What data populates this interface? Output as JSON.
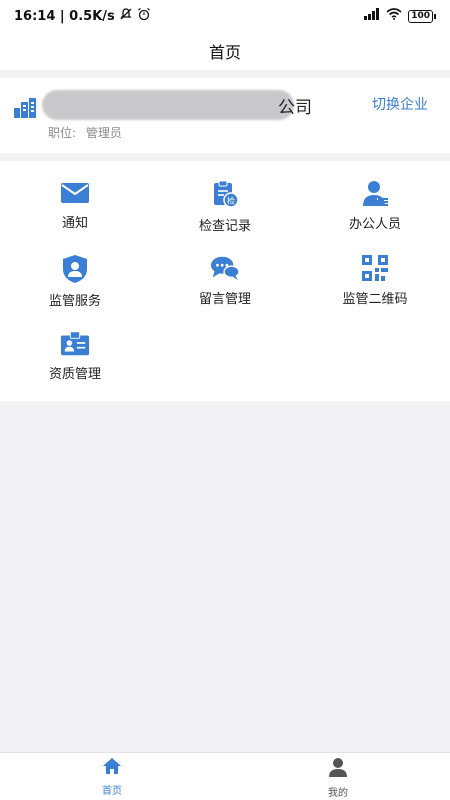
{
  "status_bar": {
    "time_speed": "16:14 | 0.5K/s",
    "battery": "100"
  },
  "nav": {
    "title": "首页"
  },
  "company": {
    "name_visible_suffix": "公司",
    "switch_label": "切换企业",
    "role_label": "职位:",
    "role_value": "管理员"
  },
  "menu": {
    "items": [
      {
        "label": "通知",
        "icon": "mail-icon"
      },
      {
        "label": "检查记录",
        "icon": "inspection-record-icon"
      },
      {
        "label": "办公人员",
        "icon": "staff-icon"
      },
      {
        "label": "监管服务",
        "icon": "shield-user-icon"
      },
      {
        "label": "留言管理",
        "icon": "chat-bubbles-icon"
      },
      {
        "label": "监管二维码",
        "icon": "qr-code-icon"
      },
      {
        "label": "资质管理",
        "icon": "id-card-icon"
      }
    ]
  },
  "tabs": [
    {
      "label": "首页",
      "icon": "home-icon",
      "active": true
    },
    {
      "label": "我的",
      "icon": "user-icon",
      "active": false
    }
  ],
  "colors": {
    "accent": "#3b7fd4",
    "inactive": "#555555"
  }
}
